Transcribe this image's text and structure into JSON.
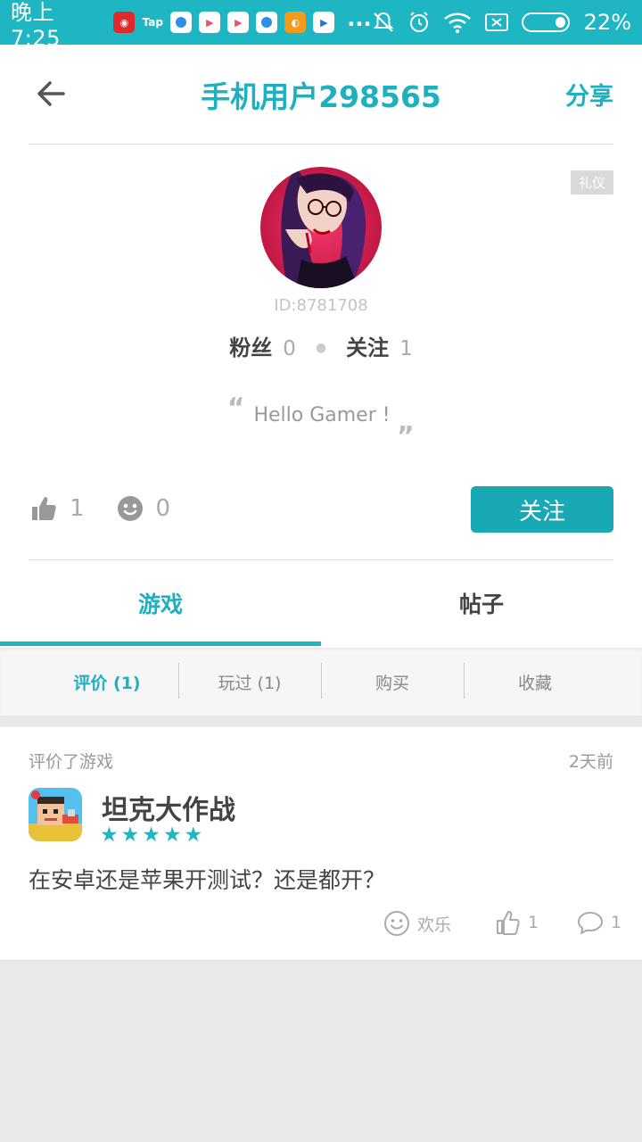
{
  "status_bar": {
    "time": "晚上7:25",
    "app_tap_label": "Tap",
    "overflow": "...",
    "battery": "22%"
  },
  "header": {
    "title": "手机用户298565",
    "share_label": "分享"
  },
  "profile": {
    "badge": "礼仪",
    "user_id": "ID:8781708",
    "fans_label": "粉丝",
    "fans_count": "0",
    "following_label": "关注",
    "following_count": "1",
    "motto": "Hello Gamer !",
    "likes_count": "1",
    "smiley_count": "0",
    "follow_button": "关注"
  },
  "tabs": [
    {
      "label": "游戏",
      "active": true
    },
    {
      "label": "帖子",
      "active": false
    }
  ],
  "subtabs": [
    {
      "label": "评价 (1)",
      "active": true
    },
    {
      "label": "玩过 (1)",
      "active": false
    },
    {
      "label": "购买",
      "active": false
    },
    {
      "label": "收藏",
      "active": false
    }
  ],
  "review": {
    "action": "评价了游戏",
    "time": "2天前",
    "game_name": "坦克大作战",
    "rating": 5,
    "text": "在安卓还是苹果开测试？还是都开？",
    "fun_label": "欢乐",
    "like_count": "1",
    "comment_count": "1"
  },
  "colors": {
    "accent": "#1fb6c4",
    "button": "#18a9b5"
  }
}
